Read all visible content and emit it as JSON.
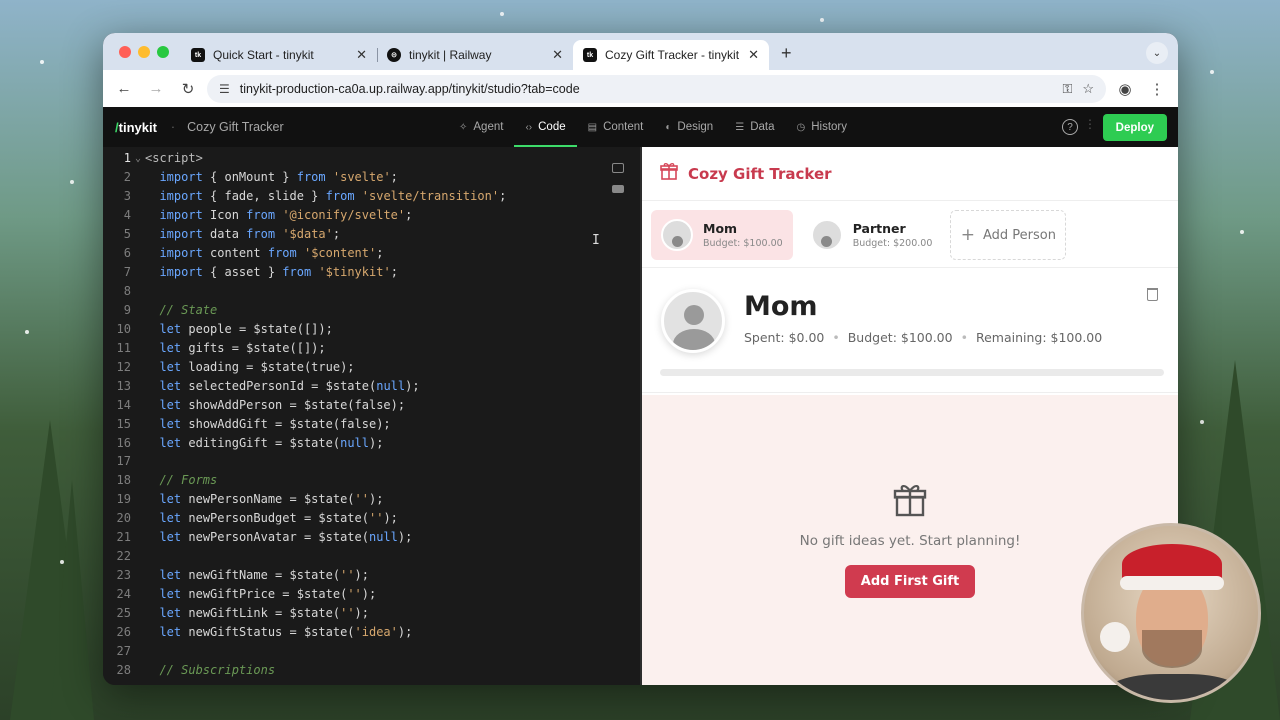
{
  "browser": {
    "tabs": [
      {
        "favicon": "tk",
        "title": "Quick Start - tinykit",
        "active": false
      },
      {
        "favicon": "railway",
        "title": "tinykit | Railway",
        "active": false
      },
      {
        "favicon": "tk",
        "title": "Cozy Gift Tracker - tinykit",
        "active": true
      }
    ],
    "url": "tinykit-production-ca0a.up.railway.app/tinykit/studio?tab=code"
  },
  "app": {
    "brand_prefix": "/",
    "brand": "tinykit",
    "project": "Cozy Gift Tracker",
    "nav": [
      {
        "icon": "sparkle-icon",
        "label": "Agent",
        "active": false
      },
      {
        "icon": "code-icon",
        "label": "Code",
        "active": true
      },
      {
        "icon": "doc-icon",
        "label": "Content",
        "active": false
      },
      {
        "icon": "palette-icon",
        "label": "Design",
        "active": false
      },
      {
        "icon": "database-icon",
        "label": "Data",
        "active": false
      },
      {
        "icon": "history-icon",
        "label": "History",
        "active": false
      }
    ],
    "deploy_label": "Deploy"
  },
  "editor": {
    "lines": [
      {
        "n": "1",
        "html": "<span class=\"tag\">&lt;script&gt;</span>"
      },
      {
        "n": "2",
        "html": "  <span class=\"kw\">import</span> { onMount } <span class=\"kw\">from</span> <span class=\"str\">'svelte'</span>;"
      },
      {
        "n": "3",
        "html": "  <span class=\"kw\">import</span> { fade, slide } <span class=\"kw\">from</span> <span class=\"str\">'svelte/transition'</span>;"
      },
      {
        "n": "4",
        "html": "  <span class=\"kw\">import</span> Icon <span class=\"kw\">from</span> <span class=\"str\">'@iconify/svelte'</span>;"
      },
      {
        "n": "5",
        "html": "  <span class=\"kw\">import</span> data <span class=\"kw\">from</span> <span class=\"str\">'$data'</span>;"
      },
      {
        "n": "6",
        "html": "  <span class=\"kw\">import</span> content <span class=\"kw\">from</span> <span class=\"str\">'$content'</span>;"
      },
      {
        "n": "7",
        "html": "  <span class=\"kw\">import</span> { asset } <span class=\"kw\">from</span> <span class=\"str\">'$tinykit'</span>;"
      },
      {
        "n": "8",
        "html": ""
      },
      {
        "n": "9",
        "html": "  <span class=\"cm\">// State</span>"
      },
      {
        "n": "10",
        "html": "  <span class=\"kw\">let</span> people = $state([]);"
      },
      {
        "n": "11",
        "html": "  <span class=\"kw\">let</span> gifts = $state([]);"
      },
      {
        "n": "12",
        "html": "  <span class=\"kw\">let</span> loading = $state(true);"
      },
      {
        "n": "13",
        "html": "  <span class=\"kw\">let</span> selectedPersonId = $state(<span class=\"nul\">null</span>);"
      },
      {
        "n": "14",
        "html": "  <span class=\"kw\">let</span> showAddPerson = $state(false);"
      },
      {
        "n": "15",
        "html": "  <span class=\"kw\">let</span> showAddGift = $state(false);"
      },
      {
        "n": "16",
        "html": "  <span class=\"kw\">let</span> editingGift = $state(<span class=\"nul\">null</span>);"
      },
      {
        "n": "17",
        "html": ""
      },
      {
        "n": "18",
        "html": "  <span class=\"cm\">// Forms</span>"
      },
      {
        "n": "19",
        "html": "  <span class=\"kw\">let</span> newPersonName = $state(<span class=\"str\">''</span>);"
      },
      {
        "n": "20",
        "html": "  <span class=\"kw\">let</span> newPersonBudget = $state(<span class=\"str\">''</span>);"
      },
      {
        "n": "21",
        "html": "  <span class=\"kw\">let</span> newPersonAvatar = $state(<span class=\"nul\">null</span>);"
      },
      {
        "n": "22",
        "html": ""
      },
      {
        "n": "23",
        "html": "  <span class=\"kw\">let</span> newGiftName = $state(<span class=\"str\">''</span>);"
      },
      {
        "n": "24",
        "html": "  <span class=\"kw\">let</span> newGiftPrice = $state(<span class=\"str\">''</span>);"
      },
      {
        "n": "25",
        "html": "  <span class=\"kw\">let</span> newGiftLink = $state(<span class=\"str\">''</span>);"
      },
      {
        "n": "26",
        "html": "  <span class=\"kw\">let</span> newGiftStatus = $state(<span class=\"str\">'idea'</span>);"
      },
      {
        "n": "27",
        "html": ""
      },
      {
        "n": "28",
        "html": "  <span class=\"cm\">// Subscriptions</span>"
      }
    ]
  },
  "preview": {
    "title": "Cozy Gift Tracker",
    "people": [
      {
        "name": "Mom",
        "budget": "Budget: $100.00",
        "selected": true
      },
      {
        "name": "Partner",
        "budget": "Budget: $200.00",
        "selected": false
      }
    ],
    "add_person_label": "Add Person",
    "selected": {
      "name": "Mom",
      "spent": "Spent: $0.00",
      "budget": "Budget: $100.00",
      "remaining": "Remaining: $100.00",
      "progress": 0
    },
    "empty_message": "No gift ideas yet. Start planning!",
    "add_first_label": "Add First Gift"
  },
  "colors": {
    "accent": "#c83a4e",
    "deploy": "#2ecc52"
  }
}
